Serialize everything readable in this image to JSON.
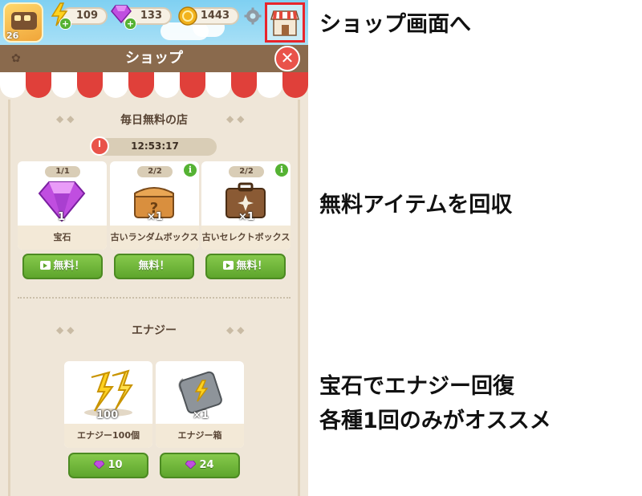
{
  "player": {
    "level": "26"
  },
  "resources": [
    {
      "name": "energy",
      "value": "109",
      "icon": "lightning-icon"
    },
    {
      "name": "gems",
      "value": "133",
      "icon": "gem-icon"
    },
    {
      "name": "coins",
      "value": "1443",
      "icon": "coin-icon"
    }
  ],
  "shop": {
    "title": "ショップ",
    "daily_section_title": "毎日無料の店",
    "timer": "12:53:17",
    "daily_items": [
      {
        "count": "1/1",
        "qty": "1",
        "name": "宝石",
        "button_label": "無料！",
        "has_video": true,
        "has_info": false,
        "icon": "gem-icon"
      },
      {
        "count": "2/2",
        "qty": "×1",
        "name": "古いランダムボックス",
        "button_label": "無料！",
        "has_video": false,
        "has_info": true,
        "icon": "random-box-icon"
      },
      {
        "count": "2/2",
        "qty": "×1",
        "name": "古いセレクトボックス",
        "button_label": "無料！",
        "has_video": true,
        "has_info": true,
        "icon": "select-box-icon"
      }
    ],
    "energy_section_title": "エナジー",
    "energy_items": [
      {
        "qty": "100",
        "name": "エナジー100個",
        "price": "10",
        "icon": "energy-pile-icon"
      },
      {
        "qty": "×1",
        "name": "エナジー箱",
        "price": "24",
        "icon": "battery-icon"
      }
    ]
  },
  "annotations": {
    "caption_1": "ショップ画面へ",
    "caption_2": "無料アイテムを回収",
    "caption_3_line1": "宝石でエナジー回復",
    "caption_3_line2": "各種1回のみがオススメ",
    "highlight_color": "#e8252c"
  }
}
